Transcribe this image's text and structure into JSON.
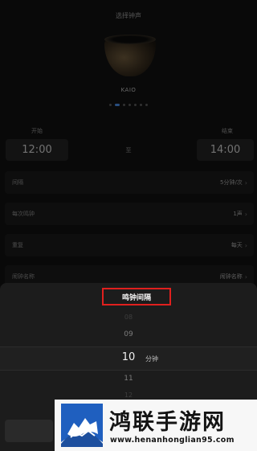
{
  "header": {
    "title": "选择钟声"
  },
  "bell": {
    "name": "KAIO",
    "carousel_count": 7,
    "carousel_active": 1
  },
  "time_range": {
    "start_label": "开始",
    "start_value": "12:00",
    "separator": "至",
    "end_label": "结束",
    "end_value": "14:00"
  },
  "settings": [
    {
      "label": "间隔",
      "value": "5分钟/次"
    },
    {
      "label": "每次鸣钟",
      "value": "1声"
    },
    {
      "label": "重复",
      "value": "每天"
    },
    {
      "label": "闹钟名称",
      "value": "闹钟名称"
    }
  ],
  "picker": {
    "title": "鸣钟间隔",
    "options": [
      "08",
      "09",
      "10",
      "11",
      "12"
    ],
    "selected_index": 2,
    "unit": "分钟"
  },
  "watermark": {
    "text": "鸿联手游网",
    "url": "www.henanhonglian95.com"
  },
  "colors": {
    "highlight_box": "#e0201e",
    "accent_dot": "#4a8ee8",
    "background": "#111111"
  }
}
